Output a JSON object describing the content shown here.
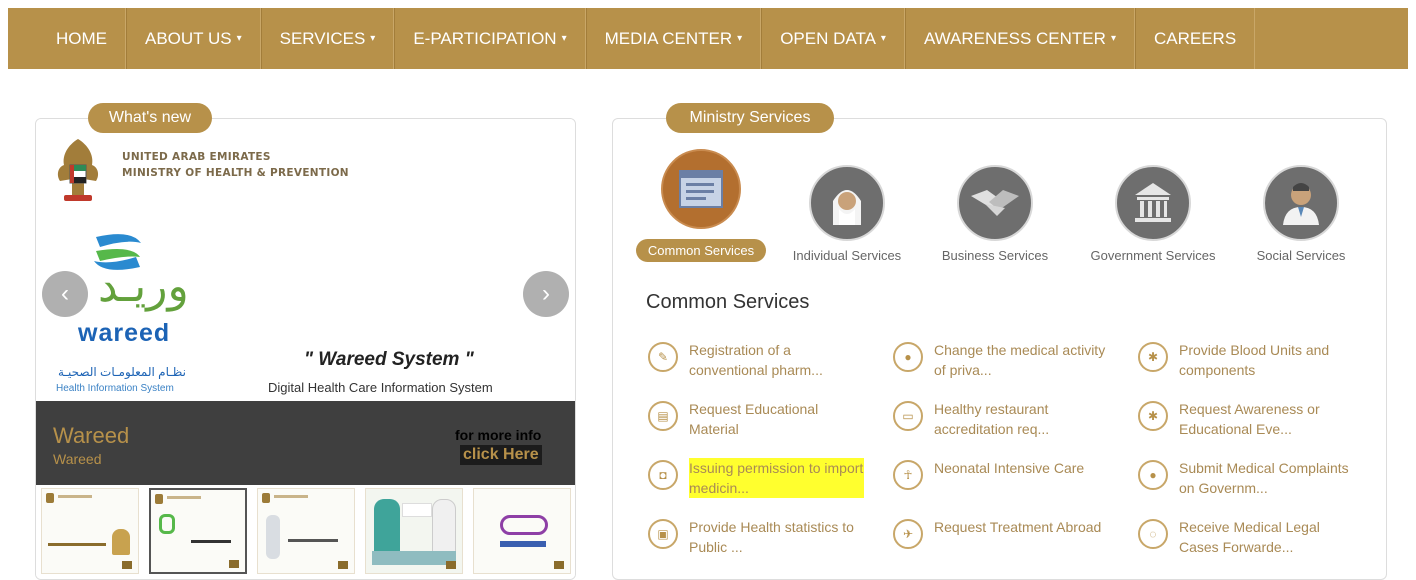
{
  "nav": {
    "items": [
      {
        "label": "HOME",
        "dropdown": false
      },
      {
        "label": "ABOUT US",
        "dropdown": true
      },
      {
        "label": "SERVICES",
        "dropdown": true
      },
      {
        "label": "E-PARTICIPATION",
        "dropdown": true
      },
      {
        "label": "MEDIA CENTER",
        "dropdown": true
      },
      {
        "label": "OPEN DATA",
        "dropdown": true
      },
      {
        "label": "AWARENESS CENTER",
        "dropdown": true
      },
      {
        "label": "CAREERS",
        "dropdown": false
      }
    ],
    "caret": "▾",
    "bg_color": "#b7914a"
  },
  "whats_new": {
    "tag": "What's new",
    "slide": {
      "org_line1": "UNITED ARAB EMIRATES",
      "org_line2": "MINISTRY OF HEALTH & PREVENTION",
      "logo_ar": "وريـد",
      "logo_en": "wareed",
      "his_ar": "نظـام المعلومـات الصحيـة",
      "his_en": "Health Information System",
      "title": "\" Wareed System \"",
      "subtitle": "Digital Health Care Information System"
    },
    "caption": {
      "title": "Wareed",
      "subtitle": "Wareed",
      "more_info": "for more info",
      "click_here": "click Here"
    },
    "arrows": {
      "prev": "‹",
      "next": "›"
    },
    "thumbnails": [
      {
        "active": false
      },
      {
        "active": true
      },
      {
        "active": false
      },
      {
        "active": false
      },
      {
        "active": false
      }
    ]
  },
  "ministry_services": {
    "tag": "Ministry Services",
    "categories": [
      {
        "label": "Common Services",
        "icon": "document-window-icon",
        "active": true
      },
      {
        "label": "Individual Services",
        "icon": "person-icon",
        "active": false
      },
      {
        "label": "Business Services",
        "icon": "handshake-icon",
        "active": false
      },
      {
        "label": "Government Services",
        "icon": "government-building-icon",
        "active": false
      },
      {
        "label": "Social Services",
        "icon": "doctor-icon",
        "active": false
      }
    ],
    "heading": "Common Services",
    "services": [
      {
        "text": "Registration of a conventional pharm...",
        "icon": "edit-icon",
        "glyph": "✎",
        "highlighted": false
      },
      {
        "text": "Change the medical activity of priva...",
        "icon": "pill-icon",
        "glyph": "●",
        "highlighted": false
      },
      {
        "text": "Provide Blood Units and components",
        "icon": "blood-icon",
        "glyph": "✱",
        "highlighted": false
      },
      {
        "text": "Request Educational Material",
        "icon": "book-icon",
        "glyph": "▤",
        "highlighted": false
      },
      {
        "text": "Healthy restaurant accreditation req...",
        "icon": "id-card-icon",
        "glyph": "▭",
        "highlighted": false
      },
      {
        "text": "Request Awareness or Educational Eve...",
        "icon": "awareness-icon",
        "glyph": "✱",
        "highlighted": false
      },
      {
        "text": "Issuing permission to import medicin...",
        "icon": "medical-kit-icon",
        "glyph": "◘",
        "highlighted": true
      },
      {
        "text": "Neonatal Intensive Care",
        "icon": "baby-icon",
        "glyph": "☥",
        "highlighted": false
      },
      {
        "text": "Submit Medical Complaints on Governm...",
        "icon": "chat-icon",
        "glyph": "●",
        "highlighted": false
      },
      {
        "text": "Provide Health statistics to Public ...",
        "icon": "document-lock-icon",
        "glyph": "▣",
        "highlighted": false
      },
      {
        "text": "Request Treatment Abroad",
        "icon": "airplane-icon",
        "glyph": "✈",
        "highlighted": false
      },
      {
        "text": "Receive Medical Legal Cases Forwarde...",
        "icon": "speech-icon",
        "glyph": "◌",
        "highlighted": false
      }
    ]
  }
}
